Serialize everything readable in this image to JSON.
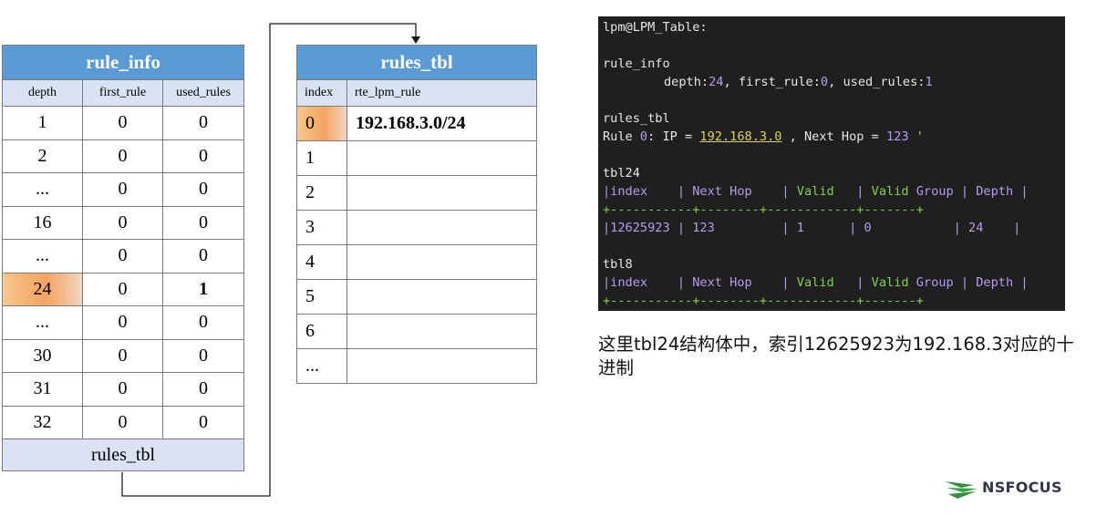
{
  "rule_info": {
    "title": "rule_info",
    "headers": [
      "depth",
      "first_rule",
      "used_rules"
    ],
    "rows": [
      {
        "depth": "1",
        "first_rule": "0",
        "used_rules": "0"
      },
      {
        "depth": "2",
        "first_rule": "0",
        "used_rules": "0"
      },
      {
        "depth": "...",
        "first_rule": "0",
        "used_rules": "0"
      },
      {
        "depth": "16",
        "first_rule": "0",
        "used_rules": "0"
      },
      {
        "depth": "...",
        "first_rule": "0",
        "used_rules": "0"
      },
      {
        "depth": "24",
        "first_rule": "0",
        "used_rules": "1"
      },
      {
        "depth": "...",
        "first_rule": "0",
        "used_rules": "0"
      },
      {
        "depth": "30",
        "first_rule": "0",
        "used_rules": "0"
      },
      {
        "depth": "31",
        "first_rule": "0",
        "used_rules": "0"
      },
      {
        "depth": "32",
        "first_rule": "0",
        "used_rules": "0"
      }
    ],
    "footer": "rules_tbl"
  },
  "rules_tbl": {
    "title": "rules_tbl",
    "headers": [
      "index",
      "rte_lpm_rule"
    ],
    "rows": [
      {
        "index": "0",
        "rule": "192.168.3.0/24"
      },
      {
        "index": "1",
        "rule": ""
      },
      {
        "index": "2",
        "rule": ""
      },
      {
        "index": "3",
        "rule": ""
      },
      {
        "index": "4",
        "rule": ""
      },
      {
        "index": "5",
        "rule": ""
      },
      {
        "index": "6",
        "rule": ""
      },
      {
        "index": "...",
        "rule": ""
      }
    ]
  },
  "terminal": {
    "header": "lpm@LPM_Table:",
    "rule_info_label": "rule_info",
    "rule_info_line": {
      "depth_key": "depth:",
      "depth_val": "24",
      "first_key": ", first_rule:",
      "first_val": "0",
      "used_key": ", used_rules:",
      "used_val": "1"
    },
    "rules_tbl_label": "rules_tbl",
    "rule_line": {
      "prefix": "Rule ",
      "num": "0",
      "mid": ": IP = ",
      "ip": "192.168.3.0",
      "hop_key": " , Next Hop = ",
      "hop_val": "123",
      "tail": " '"
    },
    "tbl24_label": "tbl24",
    "tbl24_header": {
      "p1": "|index    | Next Hop    | ",
      "valid": "Valid",
      "p2": "   | ",
      "valid_group_a": "Valid",
      "valid_group_b": " Group",
      "p3": " | Depth |"
    },
    "separator": "+-----------+--------+------------+-------+",
    "tbl24_row": "|12625923 | 123         | 1      | 0           | 24    |",
    "tbl8_label": "tbl8",
    "tbl8_header": {
      "p1": "|index    | Next Hop    | ",
      "valid": "Valid",
      "p2": "   | ",
      "valid_group_a": "Valid",
      "valid_group_b": " Group",
      "p3": " | Depth |"
    }
  },
  "caption": "这里tbl24结构体中，索引12625923为192.168.3对应的十进制",
  "logo": {
    "text": "NSFOCUS"
  },
  "colors": {
    "table_title_bg": "#5b9bd5",
    "table_header_bg": "#dae3f3",
    "highlight": "#f4a460",
    "terminal_bg": "#1f1f1f",
    "terminal_purple": "#b59cf0",
    "terminal_green": "#7fd34f",
    "terminal_yellow": "#e0d25b"
  }
}
